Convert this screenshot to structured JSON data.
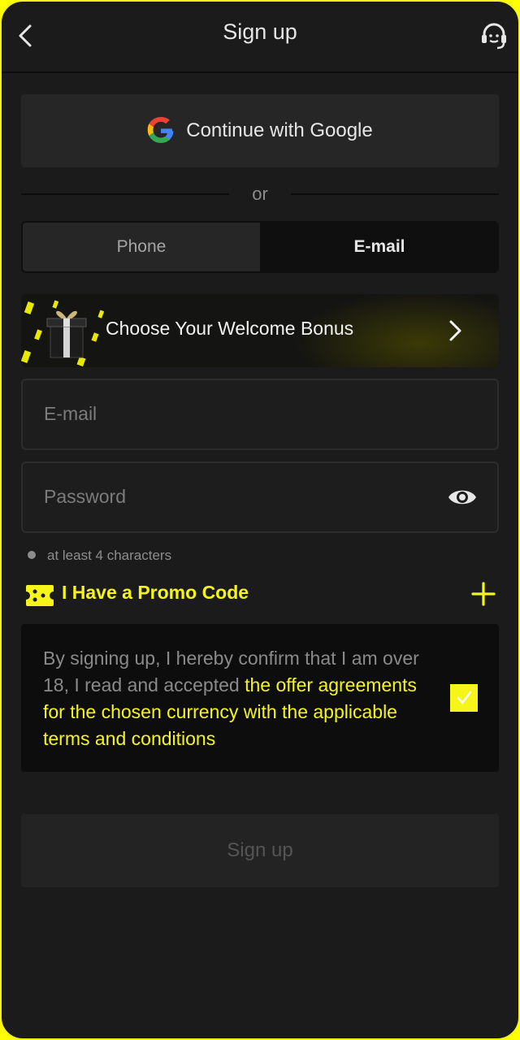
{
  "header": {
    "title": "Sign up",
    "back_icon": "chevron-left-icon",
    "support_icon": "headset-support-icon"
  },
  "social": {
    "google_label": "Continue with Google",
    "google_icon": "google-logo-icon"
  },
  "divider": {
    "text": "or"
  },
  "tabs": [
    {
      "label": "Phone",
      "active": false
    },
    {
      "label": "E-mail",
      "active": true
    }
  ],
  "bonus": {
    "label": "Choose Your Welcome Bonus",
    "icon": "gift-box-icon",
    "chevron": "chevron-right-icon"
  },
  "form": {
    "email": {
      "placeholder": "E-mail",
      "value": ""
    },
    "password": {
      "placeholder": "Password",
      "value": "",
      "icon": "eye-icon"
    },
    "password_hint": "at least 4 characters"
  },
  "promo": {
    "label": "I Have a Promo Code",
    "icon": "ticket-icon",
    "action_icon": "plus-icon"
  },
  "terms": {
    "text_plain": "By signing up, I hereby confirm that I am over 18, I read and accepted ",
    "text_link": "the offer agreements for the chosen currency with the applicable terms and conditions",
    "checked": true
  },
  "submit": {
    "label": "Sign up"
  },
  "colors": {
    "accent": "#f5f51a",
    "background": "#1b1b1b",
    "panel": "#262626"
  }
}
